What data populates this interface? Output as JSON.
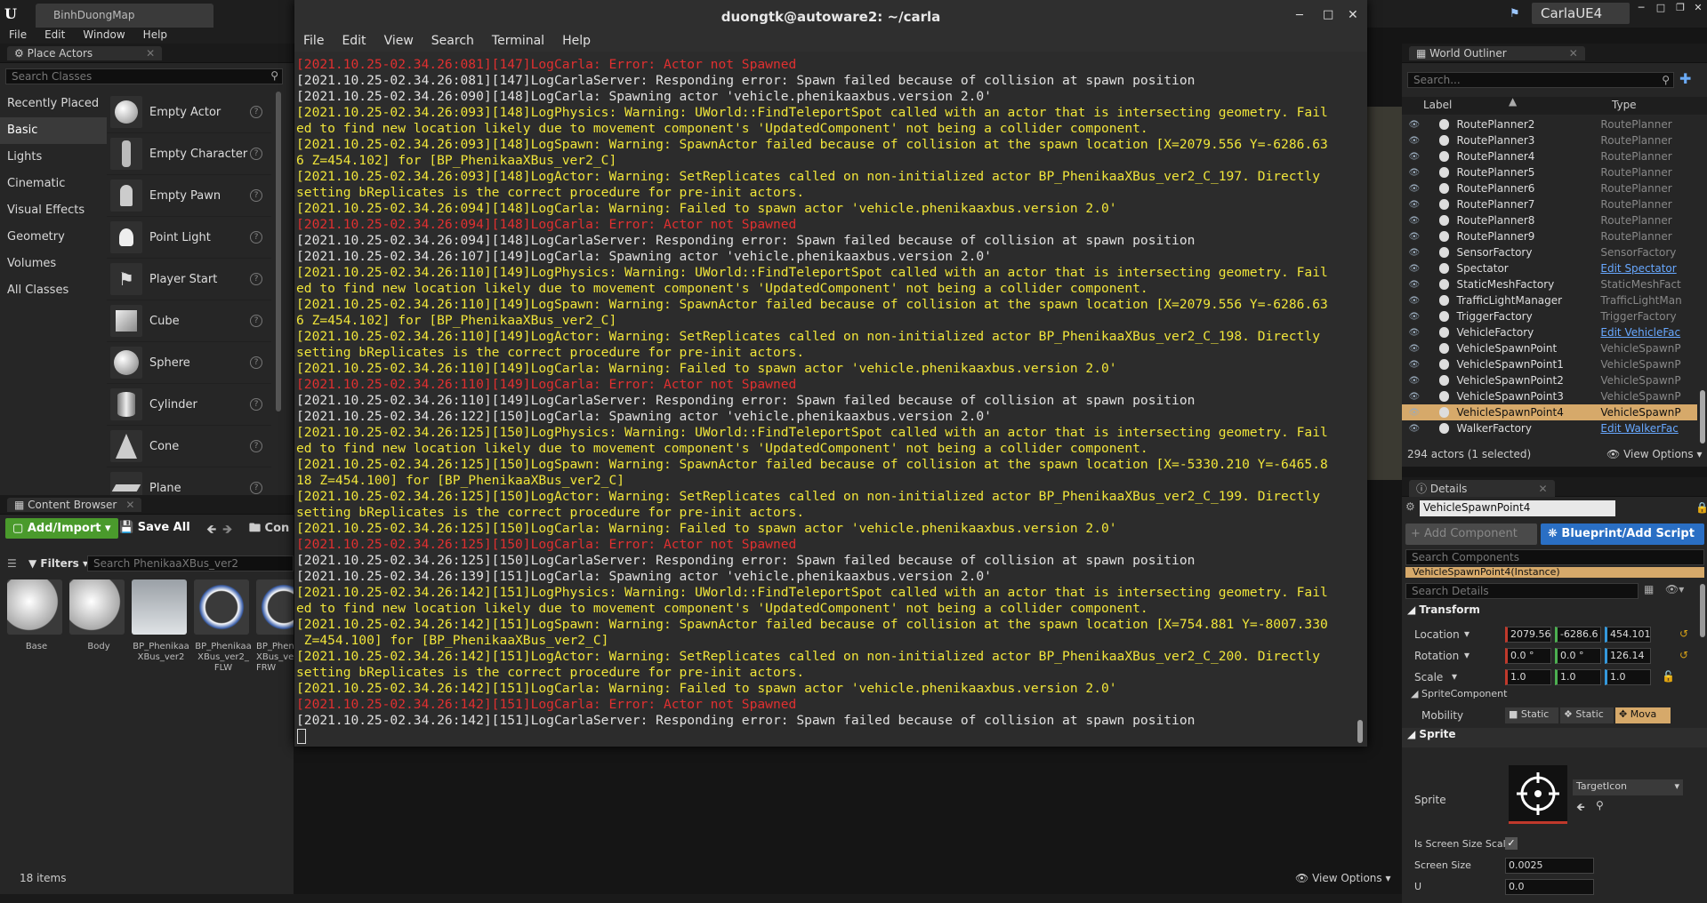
{
  "ue": {
    "tab_title": "BinhDuongMap",
    "app_name": "CarlaUE4",
    "menu": [
      "File",
      "Edit",
      "Window",
      "Help"
    ]
  },
  "place_actors": {
    "title": "Place Actors",
    "search_placeholder": "Search Classes",
    "categories": [
      "Recently Placed",
      "Basic",
      "Lights",
      "Cinematic",
      "Visual Effects",
      "Geometry",
      "Volumes",
      "All Classes"
    ],
    "actors": [
      "Empty Actor",
      "Empty Character",
      "Empty Pawn",
      "Point Light",
      "Player Start",
      "Cube",
      "Sphere",
      "Cylinder",
      "Cone",
      "Plane"
    ]
  },
  "content_browser": {
    "title": "Content Browser",
    "add_import": "Add/Import",
    "save_all": "Save All",
    "path_label": "Con",
    "filters": "Filters",
    "search_placeholder": "Search PhenikaaXBus_ver2",
    "assets": [
      "Base",
      "Body",
      "BP_PhenikaaXBus_ver2",
      "BP_PhenikaaXBus_ver2_FLW",
      "BP_PhenikaaXBus_ver2_FRW"
    ],
    "asset_labels": [
      [
        "Base"
      ],
      [
        "Body"
      ],
      [
        "BP_Phenikaa",
        "XBus_ver2"
      ],
      [
        "BP_Phenikaa",
        "XBus_ver2_",
        "FLW"
      ],
      [
        "BP_Phen",
        "XBus_ve",
        "FRW"
      ]
    ],
    "count": "18 items",
    "view_options": "View Options"
  },
  "world_outliner": {
    "title": "World Outliner",
    "search_placeholder": "Search...",
    "col_label": "Label",
    "col_type": "Type",
    "rows": [
      {
        "label": "RoutePlanner2",
        "type": "RoutePlanner",
        "link": false
      },
      {
        "label": "RoutePlanner3",
        "type": "RoutePlanner",
        "link": false
      },
      {
        "label": "RoutePlanner4",
        "type": "RoutePlanner",
        "link": false
      },
      {
        "label": "RoutePlanner5",
        "type": "RoutePlanner",
        "link": false
      },
      {
        "label": "RoutePlanner6",
        "type": "RoutePlanner",
        "link": false
      },
      {
        "label": "RoutePlanner7",
        "type": "RoutePlanner",
        "link": false
      },
      {
        "label": "RoutePlanner8",
        "type": "RoutePlanner",
        "link": false
      },
      {
        "label": "RoutePlanner9",
        "type": "RoutePlanner",
        "link": false
      },
      {
        "label": "SensorFactory",
        "type": "SensorFactory",
        "link": false
      },
      {
        "label": "Spectator",
        "type": "Edit Spectator",
        "link": true
      },
      {
        "label": "StaticMeshFactory",
        "type": "StaticMeshFact",
        "link": false
      },
      {
        "label": "TrafficLightManager",
        "type": "TrafficLightMan",
        "link": false
      },
      {
        "label": "TriggerFactory",
        "type": "TriggerFactory",
        "link": false
      },
      {
        "label": "VehicleFactory",
        "type": "Edit VehicleFac",
        "link": true
      },
      {
        "label": "VehicleSpawnPoint",
        "type": "VehicleSpawnP",
        "link": false
      },
      {
        "label": "VehicleSpawnPoint1",
        "type": "VehicleSpawnP",
        "link": false
      },
      {
        "label": "VehicleSpawnPoint2",
        "type": "VehicleSpawnP",
        "link": false
      },
      {
        "label": "VehicleSpawnPoint3",
        "type": "VehicleSpawnP",
        "link": false
      },
      {
        "label": "VehicleSpawnPoint4",
        "type": "VehicleSpawnP",
        "link": false,
        "selected": true
      },
      {
        "label": "WalkerFactory",
        "type": "Edit WalkerFac",
        "link": true
      }
    ],
    "footer": "294 actors (1 selected)",
    "view_options": "View Options"
  },
  "details": {
    "title": "Details",
    "name": "VehicleSpawnPoint4",
    "add_component": "+ Add Component",
    "blueprint": "Blueprint/Add Script",
    "search_components": "Search Components",
    "instance": "VehicleSpawnPoint4(Instance)",
    "search_details": "Search Details",
    "transform": "Transform",
    "location_label": "Location",
    "location": [
      "2079.56",
      "-6286.6",
      "454.101"
    ],
    "rotation_label": "Rotation",
    "rotation": [
      "0.0 °",
      "0.0 °",
      "126.14"
    ],
    "scale_label": "Scale",
    "scale": [
      "1.0",
      "1.0",
      "1.0"
    ],
    "sprite_component": "SpriteComponent",
    "mobility_label": "Mobility",
    "mobility": [
      "Static",
      "Static",
      "Mova"
    ],
    "sprite_section": "Sprite",
    "sprite_label": "Sprite",
    "sprite_asset": "TargetIcon",
    "screen_size_scale": "Is Screen Size Scal",
    "screen_size_label": "Screen Size",
    "screen_size": "0.0025",
    "u_label": "U",
    "u_value": "0.0"
  },
  "terminal": {
    "title": "duongtk@autoware2: ~/carla",
    "menu": [
      "File",
      "Edit",
      "View",
      "Search",
      "Terminal",
      "Help"
    ],
    "lines": [
      {
        "c": "r",
        "t": "[2021.10.25-02.34.26:081][147]LogCarla: Error: Actor not Spawned"
      },
      {
        "c": "w",
        "t": "[2021.10.25-02.34.26:081][147]LogCarlaServer: Responding error: Spawn failed because of collision at spawn position"
      },
      {
        "c": "w",
        "t": "[2021.10.25-02.34.26:090][148]LogCarla: Spawning actor 'vehicle.phenikaaxbus.version 2.0'"
      },
      {
        "c": "y",
        "t": "[2021.10.25-02.34.26:093][148]LogPhysics: Warning: UWorld::FindTeleportSpot called with an actor that is intersecting geometry. Fail"
      },
      {
        "c": "y",
        "t": "ed to find new location likely due to movement component's 'UpdatedComponent' not being a collider component."
      },
      {
        "c": "y",
        "t": "[2021.10.25-02.34.26:093][148]LogSpawn: Warning: SpawnActor failed because of collision at the spawn location [X=2079.556 Y=-6286.63"
      },
      {
        "c": "y",
        "t": "6 Z=454.102] for [BP_PhenikaaXBus_ver2_C]"
      },
      {
        "c": "y",
        "t": "[2021.10.25-02.34.26:093][148]LogActor: Warning: SetReplicates called on non-initialized actor BP_PhenikaaXBus_ver2_C_197. Directly"
      },
      {
        "c": "y",
        "t": "setting bReplicates is the correct procedure for pre-init actors."
      },
      {
        "c": "y",
        "t": "[2021.10.25-02.34.26:094][148]LogCarla: Warning: Failed to spawn actor 'vehicle.phenikaaxbus.version 2.0'"
      },
      {
        "c": "r",
        "t": "[2021.10.25-02.34.26:094][148]LogCarla: Error: Actor not Spawned"
      },
      {
        "c": "w",
        "t": "[2021.10.25-02.34.26:094][148]LogCarlaServer: Responding error: Spawn failed because of collision at spawn position"
      },
      {
        "c": "w",
        "t": "[2021.10.25-02.34.26:107][149]LogCarla: Spawning actor 'vehicle.phenikaaxbus.version 2.0'"
      },
      {
        "c": "y",
        "t": "[2021.10.25-02.34.26:110][149]LogPhysics: Warning: UWorld::FindTeleportSpot called with an actor that is intersecting geometry. Fail"
      },
      {
        "c": "y",
        "t": "ed to find new location likely due to movement component's 'UpdatedComponent' not being a collider component."
      },
      {
        "c": "y",
        "t": "[2021.10.25-02.34.26:110][149]LogSpawn: Warning: SpawnActor failed because of collision at the spawn location [X=2079.556 Y=-6286.63"
      },
      {
        "c": "y",
        "t": "6 Z=454.102] for [BP_PhenikaaXBus_ver2_C]"
      },
      {
        "c": "y",
        "t": "[2021.10.25-02.34.26:110][149]LogActor: Warning: SetReplicates called on non-initialized actor BP_PhenikaaXBus_ver2_C_198. Directly"
      },
      {
        "c": "y",
        "t": "setting bReplicates is the correct procedure for pre-init actors."
      },
      {
        "c": "y",
        "t": "[2021.10.25-02.34.26:110][149]LogCarla: Warning: Failed to spawn actor 'vehicle.phenikaaxbus.version 2.0'"
      },
      {
        "c": "r",
        "t": "[2021.10.25-02.34.26:110][149]LogCarla: Error: Actor not Spawned"
      },
      {
        "c": "w",
        "t": "[2021.10.25-02.34.26:110][149]LogCarlaServer: Responding error: Spawn failed because of collision at spawn position"
      },
      {
        "c": "w",
        "t": "[2021.10.25-02.34.26:122][150]LogCarla: Spawning actor 'vehicle.phenikaaxbus.version 2.0'"
      },
      {
        "c": "y",
        "t": "[2021.10.25-02.34.26:125][150]LogPhysics: Warning: UWorld::FindTeleportSpot called with an actor that is intersecting geometry. Fail"
      },
      {
        "c": "y",
        "t": "ed to find new location likely due to movement component's 'UpdatedComponent' not being a collider component."
      },
      {
        "c": "y",
        "t": "[2021.10.25-02.34.26:125][150]LogSpawn: Warning: SpawnActor failed because of collision at the spawn location [X=-5330.210 Y=-6465.8"
      },
      {
        "c": "y",
        "t": "18 Z=454.100] for [BP_PhenikaaXBus_ver2_C]"
      },
      {
        "c": "y",
        "t": "[2021.10.25-02.34.26:125][150]LogActor: Warning: SetReplicates called on non-initialized actor BP_PhenikaaXBus_ver2_C_199. Directly"
      },
      {
        "c": "y",
        "t": "setting bReplicates is the correct procedure for pre-init actors."
      },
      {
        "c": "y",
        "t": "[2021.10.25-02.34.26:125][150]LogCarla: Warning: Failed to spawn actor 'vehicle.phenikaaxbus.version 2.0'"
      },
      {
        "c": "r",
        "t": "[2021.10.25-02.34.26:125][150]LogCarla: Error: Actor not Spawned"
      },
      {
        "c": "w",
        "t": "[2021.10.25-02.34.26:125][150]LogCarlaServer: Responding error: Spawn failed because of collision at spawn position"
      },
      {
        "c": "w",
        "t": "[2021.10.25-02.34.26:139][151]LogCarla: Spawning actor 'vehicle.phenikaaxbus.version 2.0'"
      },
      {
        "c": "y",
        "t": "[2021.10.25-02.34.26:142][151]LogPhysics: Warning: UWorld::FindTeleportSpot called with an actor that is intersecting geometry. Fail"
      },
      {
        "c": "y",
        "t": "ed to find new location likely due to movement component's 'UpdatedComponent' not being a collider component."
      },
      {
        "c": "y",
        "t": "[2021.10.25-02.34.26:142][151]LogSpawn: Warning: SpawnActor failed because of collision at the spawn location [X=754.881 Y=-8007.330"
      },
      {
        "c": "y",
        "t": " Z=454.100] for [BP_PhenikaaXBus_ver2_C]"
      },
      {
        "c": "y",
        "t": "[2021.10.25-02.34.26:142][151]LogActor: Warning: SetReplicates called on non-initialized actor BP_PhenikaaXBus_ver2_C_200. Directly"
      },
      {
        "c": "y",
        "t": "setting bReplicates is the correct procedure for pre-init actors."
      },
      {
        "c": "y",
        "t": "[2021.10.25-02.34.26:142][151]LogCarla: Warning: Failed to spawn actor 'vehicle.phenikaaxbus.version 2.0'"
      },
      {
        "c": "r",
        "t": "[2021.10.25-02.34.26:142][151]LogCarla: Error: Actor not Spawned"
      },
      {
        "c": "w",
        "t": "[2021.10.25-02.34.26:142][151]LogCarlaServer: Responding error: Spawn failed because of collision at spawn position"
      }
    ]
  }
}
